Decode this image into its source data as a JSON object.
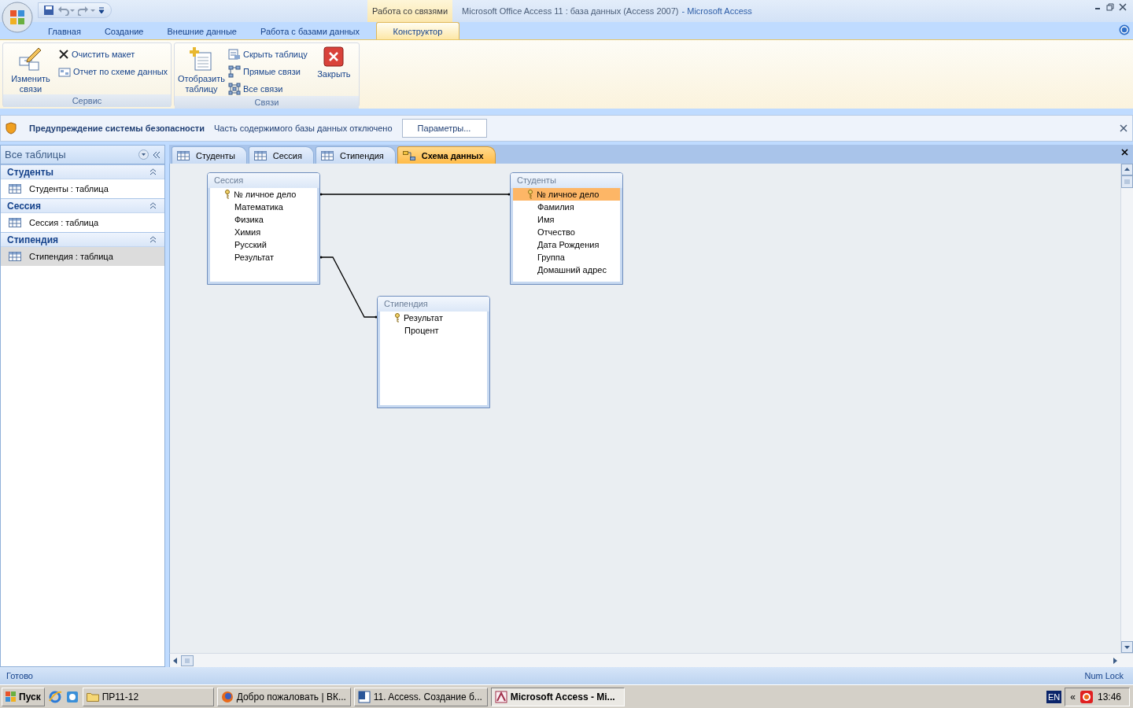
{
  "title_bar": {
    "context_group": "Работа со связями",
    "document": "Microsoft Office Access 11 : база данных (Access 2007)",
    "separator": "-",
    "app": "Microsoft Access"
  },
  "ribbon_tabs": [
    {
      "label": "Главная",
      "selected": false
    },
    {
      "label": "Создание",
      "selected": false
    },
    {
      "label": "Внешние данные",
      "selected": false
    },
    {
      "label": "Работа с базами данных",
      "selected": false
    },
    {
      "label": "Конструктор",
      "selected": true
    }
  ],
  "ribbon_groups": [
    {
      "label": "Сервис",
      "buttons": [
        {
          "kind": "large",
          "label": "Изменить связи"
        },
        {
          "kind": "small",
          "label": "Очистить макет"
        },
        {
          "kind": "small",
          "label": "Отчет по схеме данных"
        }
      ]
    },
    {
      "label": "Связи",
      "buttons": [
        {
          "kind": "large",
          "label": "Отобразить таблицу"
        },
        {
          "kind": "small",
          "label": "Скрыть таблицу"
        },
        {
          "kind": "small",
          "label": "Прямые связи"
        },
        {
          "kind": "small",
          "label": "Все связи"
        },
        {
          "kind": "large",
          "label": "Закрыть"
        }
      ]
    }
  ],
  "security_bar": {
    "title": "Предупреждение системы безопасности",
    "message": "Часть содержимого базы данных отключено",
    "button": "Параметры..."
  },
  "nav_pane": {
    "title": "Все таблицы",
    "groups": [
      {
        "title": "Студенты",
        "items": [
          {
            "label": "Студенты : таблица",
            "selected": false
          }
        ]
      },
      {
        "title": "Сессия",
        "items": [
          {
            "label": "Сессия : таблица",
            "selected": false
          }
        ]
      },
      {
        "title": "Стипендия",
        "items": [
          {
            "label": "Стипендия : таблица",
            "selected": true
          }
        ]
      }
    ]
  },
  "doc_tabs": [
    {
      "label": "Студенты",
      "kind": "table",
      "selected": false
    },
    {
      "label": "Сессия",
      "kind": "table",
      "selected": false
    },
    {
      "label": "Стипендия",
      "kind": "table",
      "selected": false
    },
    {
      "label": "Схема данных",
      "kind": "diagram",
      "selected": true
    }
  ],
  "diagram": {
    "tables": [
      {
        "title": "Сессия",
        "fields": [
          {
            "name": "№ личное дело",
            "key": true,
            "selected": false
          },
          {
            "name": "Математика",
            "key": false,
            "selected": false
          },
          {
            "name": "Физика",
            "key": false,
            "selected": false
          },
          {
            "name": "Химия",
            "key": false,
            "selected": false
          },
          {
            "name": "Русский",
            "key": false,
            "selected": false
          },
          {
            "name": "Результат",
            "key": false,
            "selected": false
          }
        ]
      },
      {
        "title": "Студенты",
        "fields": [
          {
            "name": "№ личное дело",
            "key": true,
            "selected": true
          },
          {
            "name": "Фамилия",
            "key": false,
            "selected": false
          },
          {
            "name": "Имя",
            "key": false,
            "selected": false
          },
          {
            "name": "Отчество",
            "key": false,
            "selected": false
          },
          {
            "name": "Дата Рождения",
            "key": false,
            "selected": false
          },
          {
            "name": "Группа",
            "key": false,
            "selected": false
          },
          {
            "name": "Домашний адрес",
            "key": false,
            "selected": false
          }
        ]
      },
      {
        "title": "Стипендия",
        "fields": [
          {
            "name": "Результат",
            "key": true,
            "selected": false
          },
          {
            "name": "Процент",
            "key": false,
            "selected": false
          }
        ]
      }
    ]
  },
  "status_bar": {
    "left": "Готово",
    "right": "Num Lock"
  },
  "taskbar": {
    "start": "Пуск",
    "items": [
      {
        "label": "ПР11-12",
        "kind": "folder",
        "selected": false
      },
      {
        "label": "Добро пожаловать | ВК...",
        "kind": "browser",
        "selected": false
      },
      {
        "label": "11. Access. Создание б...",
        "kind": "word",
        "selected": false
      },
      {
        "label": "Microsoft Access - Mi...",
        "kind": "access",
        "selected": true
      }
    ],
    "chevron": "«",
    "language": "EN",
    "clock": "13:46"
  }
}
